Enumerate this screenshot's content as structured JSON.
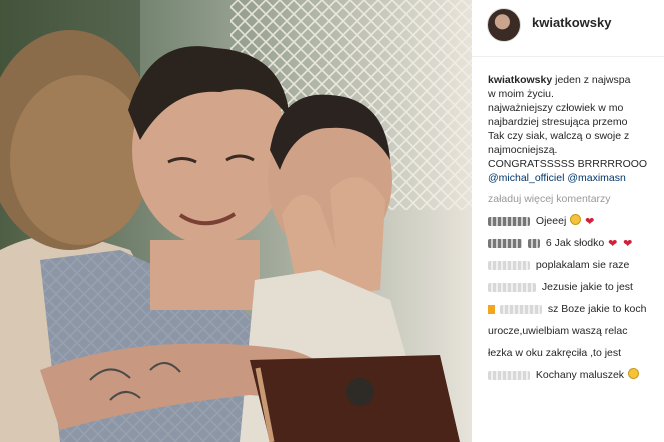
{
  "post": {
    "username": "kwiatkowsky",
    "caption_lines": [
      "jeden z najwspa",
      "w moim życiu.",
      "najważniejszy człowiek w mo",
      "najbardziej stresująca przemo",
      "Tak czy siak, walczą o swoje z",
      "najmocniejszą.",
      "CONGRATSSSSS BRRRRROOO"
    ],
    "mentions": [
      "@michal_officiel",
      "@maximasn"
    ],
    "load_more": "załaduj więcej komentarzy"
  },
  "comments": [
    {
      "text": "Ojeeej",
      "emoji": [
        "smile-emoji",
        "heart-emoji"
      ]
    },
    {
      "text": "6 Jak słodko",
      "emoji": [
        "heart-emoji",
        "heart-emoji"
      ]
    },
    {
      "text": "poplakalam sie raze",
      "emoji": []
    },
    {
      "text": "Jezusie jakie to jest",
      "emoji": []
    },
    {
      "text": "sz Boze jakie to koch",
      "emoji": []
    },
    {
      "text": "urocze,uwielbiam waszą relac",
      "emoji": []
    },
    {
      "text": "łezka w oku zakręciła ,to jest",
      "emoji": []
    },
    {
      "text": "Kochany maluszek",
      "emoji": [
        "heart-eyes-emoji"
      ]
    }
  ],
  "colors": {
    "username": "#262626",
    "mention": "#003569",
    "muted": "#999999",
    "heart": "#d0213b"
  }
}
